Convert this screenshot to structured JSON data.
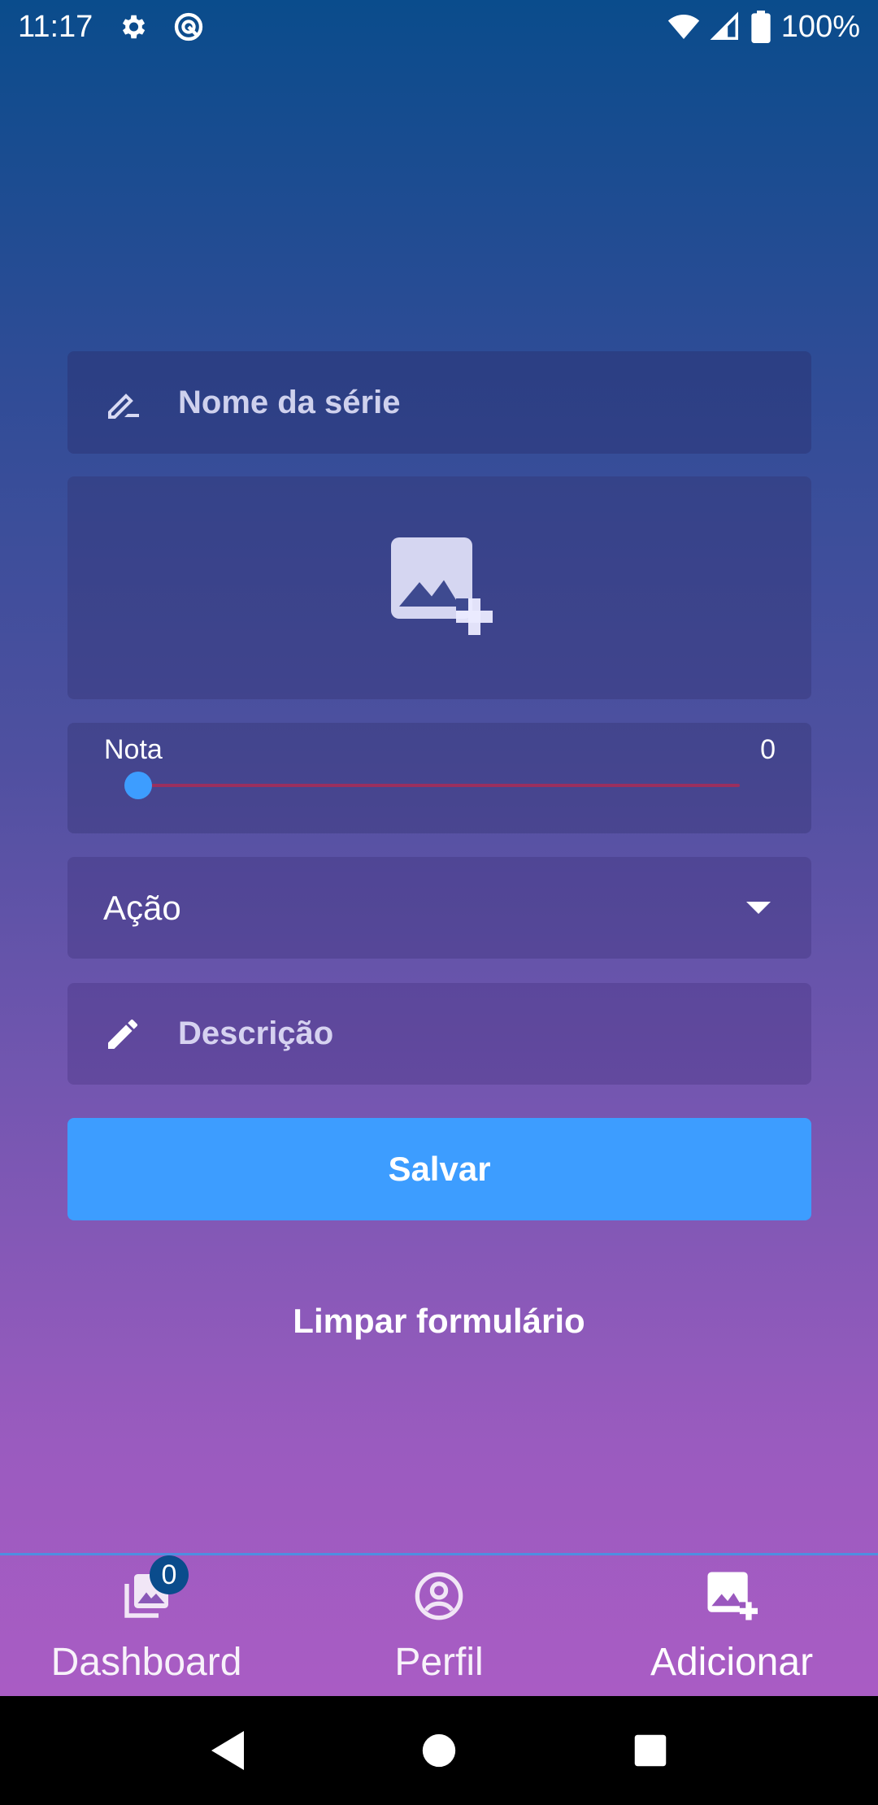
{
  "status_bar": {
    "time": "11:17",
    "battery": "100%",
    "icons": [
      "settings-icon",
      "no-sim-icon",
      "wifi-icon",
      "signal-icon",
      "battery-icon"
    ]
  },
  "form": {
    "name_placeholder": "Nome da série",
    "image_icon": "add-photo-icon",
    "rating": {
      "label": "Nota",
      "value": "0",
      "level": 0
    },
    "genre": {
      "selected": "Ação"
    },
    "description_placeholder": "Descrição",
    "save_label": "Salvar",
    "clear_label": "Limpar formulário"
  },
  "bottom_nav": {
    "items": [
      {
        "label": "Dashboard",
        "icon": "photo-library-icon",
        "badge": "0"
      },
      {
        "label": "Perfil",
        "icon": "account-circle-icon"
      },
      {
        "label": "Adicionar",
        "icon": "add-photo-icon"
      }
    ]
  },
  "colors": {
    "accent": "#3d9dff",
    "slider_track": "#9b2f5f",
    "gradient_top": "#0a4c8c",
    "gradient_bottom": "#b05cc6"
  }
}
